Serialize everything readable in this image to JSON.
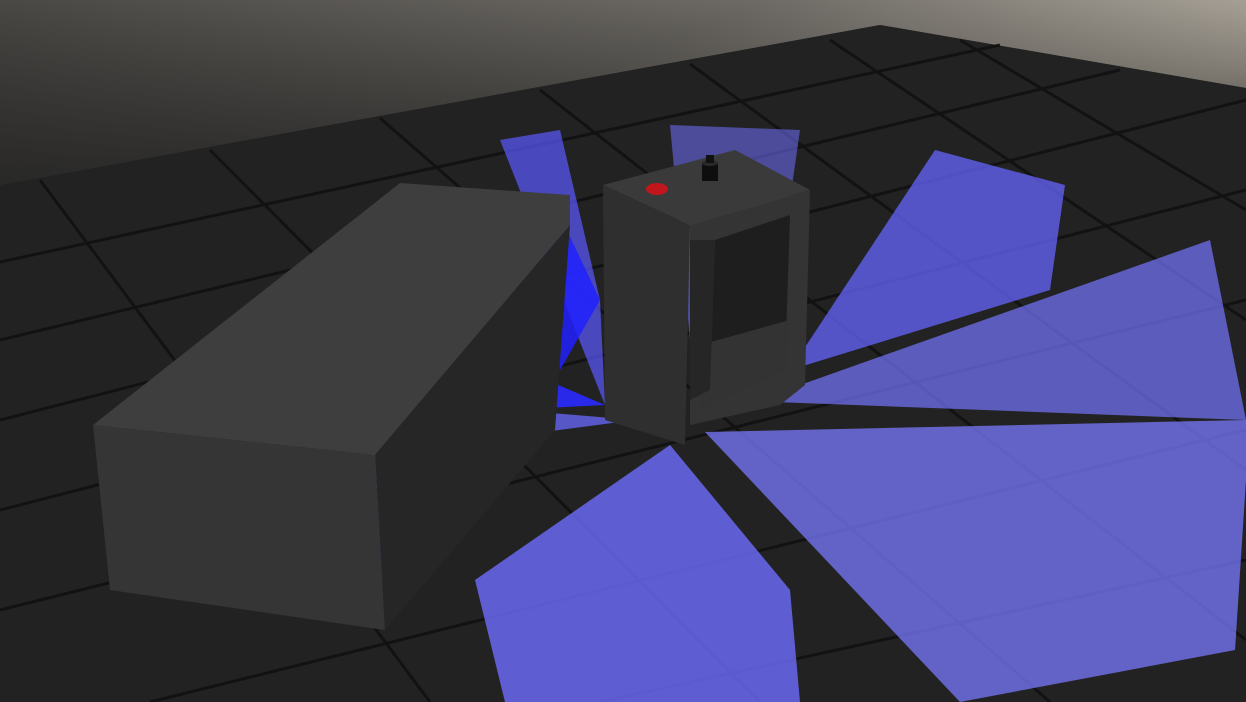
{
  "scene": {
    "type": "3d-simulation-viewport",
    "objects": [
      {
        "name": "box-obstacle",
        "kind": "rectangular block",
        "color": "#3d3d3d"
      },
      {
        "name": "robot-frame",
        "kind": "hollow rectangular frame robot",
        "color": "#3a3a3a"
      },
      {
        "name": "red-marker",
        "kind": "small red object on robot top",
        "color": "#c0161c"
      },
      {
        "name": "black-sensor",
        "kind": "small black cylinder on robot top",
        "color": "#111111"
      }
    ],
    "sensors": {
      "kind": "laser range scans",
      "color": "#6b6bff",
      "count": 8
    },
    "floor": {
      "color": "#222222",
      "grid_color": "#0e0e0e"
    },
    "sky": {
      "top_color": "#a09a90",
      "bottom_color": "#242424"
    }
  }
}
